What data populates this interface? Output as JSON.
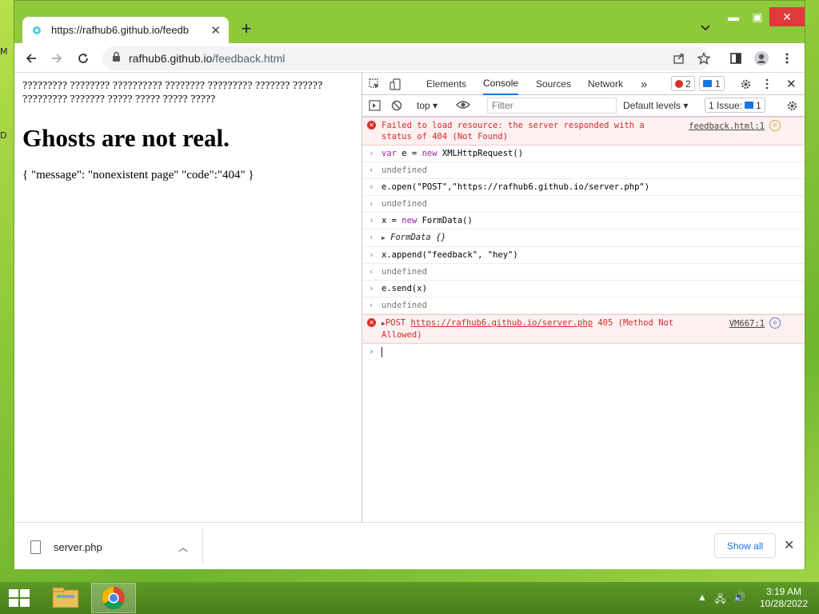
{
  "desktop": {
    "icon_text_1": "M",
    "icon_text_2": "D"
  },
  "browser": {
    "tab_title": "https://rafhub6.github.io/feedba",
    "address_host": "rafhub6.github.io",
    "address_path": "/feedback.html"
  },
  "page": {
    "garbled_text": "????????? ???????? ?????????? ???????? ????????? ??????? ?????? ????????? ??????? ????? ????? ????? ?????",
    "heading": "Ghosts are not real.",
    "json_text": "{ \"message\": \"nonexistent page\" \"code\":\"404\" }"
  },
  "devtools": {
    "tabs": [
      "Elements",
      "Console",
      "Sources",
      "Network"
    ],
    "more_tabs": "»",
    "error_count": "2",
    "message_count": "1",
    "context": "top",
    "filter_placeholder": "Filter",
    "levels": "Default levels",
    "issues_label": "1 Issue:",
    "issues_count": "1"
  },
  "console": {
    "error1_text": "Failed to load resource: the server responded with a\nstatus of 404 (Not Found)",
    "error1_src": "feedback.html:1",
    "cmd1_kw": "var",
    "cmd1_a": " e = ",
    "cmd1_kw2": "new",
    "cmd1_b": " XMLHttpRequest()",
    "out1": "undefined",
    "cmd2": "e.open(\"POST\",\"https://rafhub6.github.io/server.php\")",
    "out2": "undefined",
    "cmd3_a": "x = ",
    "cmd3_kw": "new",
    "cmd3_b": " FormData()",
    "out3": "FormData {}",
    "cmd4": "x.append(\"feedback\", \"hey\")",
    "out4": "undefined",
    "cmd5": "e.send(x)",
    "out5": "undefined",
    "error2_prefix": "POST ",
    "error2_link": "https://rafhub6.github.io/server.php",
    "error2_suffix": " 405 (Method Not\nAllowed)",
    "error2_src": "VM667:1"
  },
  "downloads": {
    "file_name": "server.php",
    "show_all": "Show all"
  },
  "taskbar": {
    "time": "3:19 AM",
    "date": "10/28/2022"
  },
  "colors": {
    "desktop_green": "#8ec93c",
    "accent_blue": "#1a73e8",
    "error_red": "#d32b2b",
    "close_red": "#e0393a"
  }
}
